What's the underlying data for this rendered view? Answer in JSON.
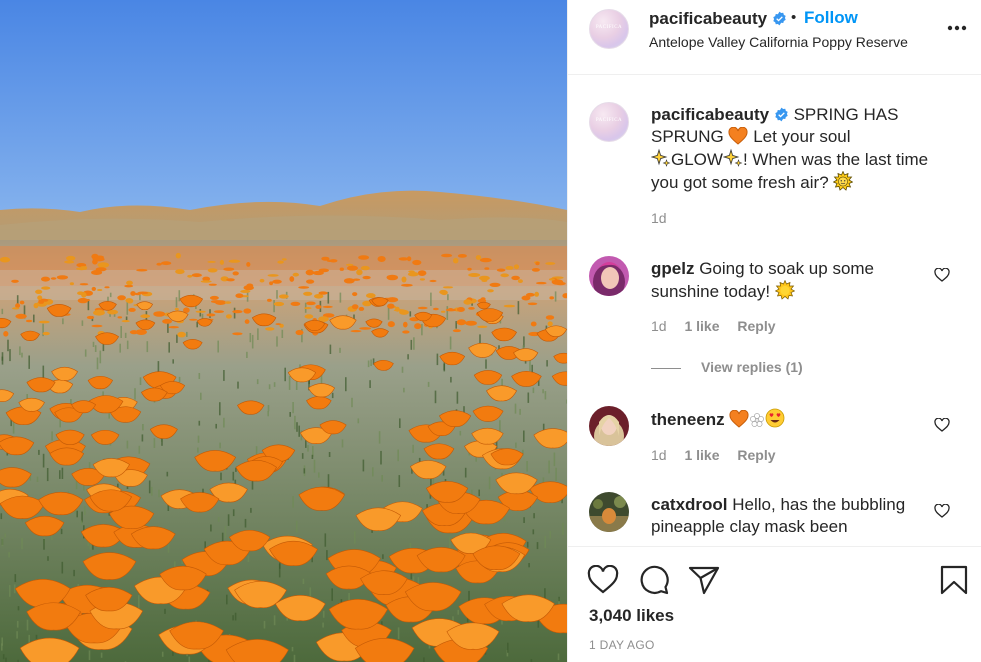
{
  "post": {
    "username": "pacificabeauty",
    "follow_label": "Follow",
    "dot": "•",
    "location": "Antelope Valley California Poppy Reserve",
    "avatar_text": "PACIFICA"
  },
  "caption": {
    "username": "pacificabeauty",
    "line1": "SPRING HAS",
    "line2_a": "SPRUNG",
    "line2_b": "Let your soul",
    "line3_a": "GLOW",
    "line3_b": "! When was the last time",
    "line4": "you got some fresh air?",
    "time": "1d"
  },
  "comments": [
    {
      "username": "gpelz",
      "text_line1": "Going to soak up some",
      "text_line2": "sunshine today!",
      "time": "1d",
      "likes": "1 like",
      "reply": "Reply",
      "view_replies": "View replies (1)"
    },
    {
      "username": "theneenz",
      "time": "1d",
      "likes": "1 like",
      "reply": "Reply"
    },
    {
      "username": "catxdrool",
      "text_line1": "Hello, has the bubbling",
      "text_line2": "pineapple clay mask been"
    }
  ],
  "footer": {
    "likes": "3,040 likes",
    "ago": "1 DAY AGO"
  },
  "icons": {
    "verified": "verified-badge-icon",
    "more": "more-options-icon",
    "heart": "heart-icon",
    "comment": "comment-icon",
    "share": "share-icon",
    "save": "bookmark-icon"
  },
  "colors": {
    "accent": "#0095f6",
    "text": "#262626",
    "muted": "#8e8e8e",
    "sky": "#5e96e6",
    "poppy": "#f07a12"
  }
}
